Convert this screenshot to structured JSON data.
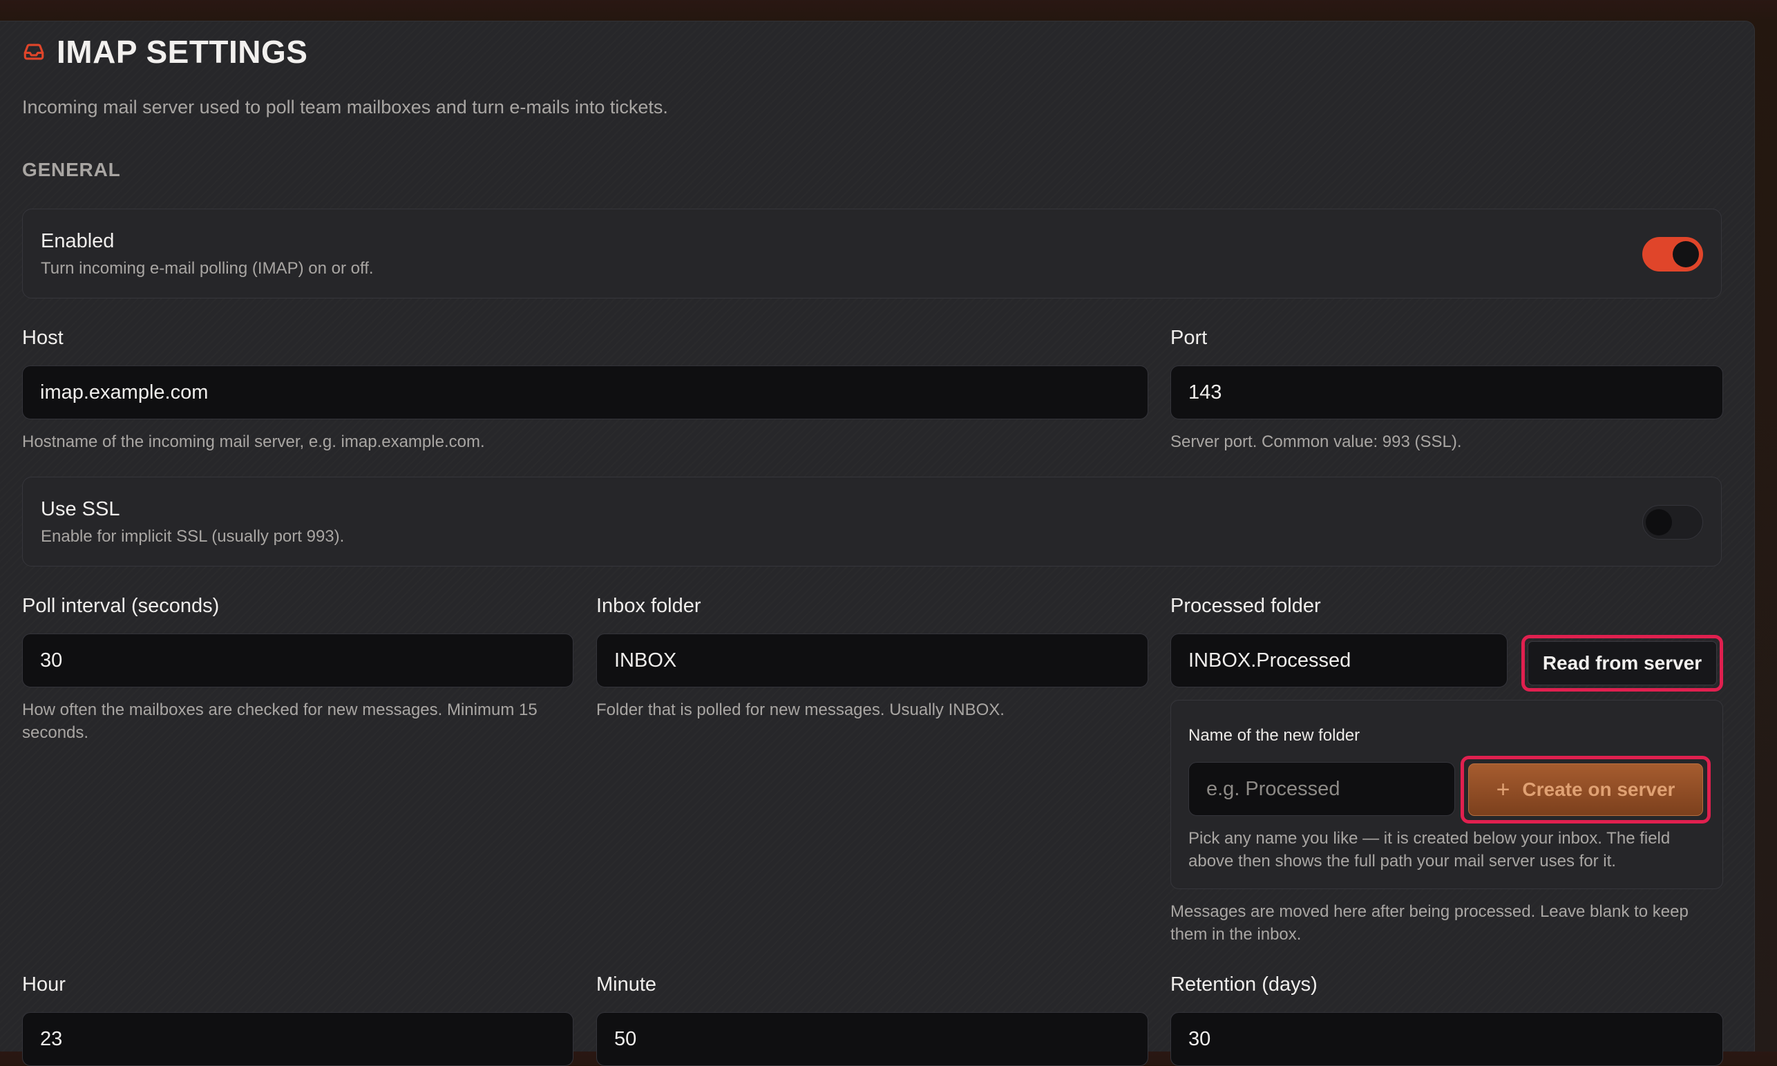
{
  "header": {
    "icon": "inbox-icon",
    "title": "IMAP SETTINGS",
    "subtitle": "Incoming mail server used to poll team mailboxes and turn e-mails into tickets."
  },
  "section_general": "GENERAL",
  "enabled": {
    "title": "Enabled",
    "description": "Turn incoming e-mail polling (IMAP) on or off.",
    "state": true
  },
  "host": {
    "label": "Host",
    "value": "imap.example.com",
    "help": "Hostname of the incoming mail server, e.g. imap.example.com."
  },
  "port": {
    "label": "Port",
    "value": "143",
    "help": "Server port. Common value: 993 (SSL)."
  },
  "ssl": {
    "title": "Use SSL",
    "description": "Enable for implicit SSL (usually port 993).",
    "state": false
  },
  "poll_interval": {
    "label": "Poll interval (seconds)",
    "value": "30",
    "help": "How often the mailboxes are checked for new messages. Minimum 15 seconds."
  },
  "inbox_folder": {
    "label": "Inbox folder",
    "value": "INBOX",
    "help": "Folder that is polled for new messages. Usually INBOX."
  },
  "processed_folder": {
    "label": "Processed folder",
    "value": "INBOX.Processed",
    "read_button": "Read from server",
    "new_folder_label": "Name of the new folder",
    "new_folder_placeholder": "e.g. Processed",
    "create_button": "Create on server",
    "create_hint": "Pick any name you like — it is created below your inbox. The field above then shows the full path your mail server uses for it.",
    "help": "Messages are moved here after being processed. Leave blank to keep them in the inbox."
  },
  "hour": {
    "label": "Hour",
    "value": "23"
  },
  "minute": {
    "label": "Minute",
    "value": "50"
  },
  "retention": {
    "label": "Retention (days)",
    "value": "30"
  },
  "colors": {
    "accent": "#e0452a",
    "highlight": "#e0204f",
    "create_button": "#a65c2f"
  }
}
